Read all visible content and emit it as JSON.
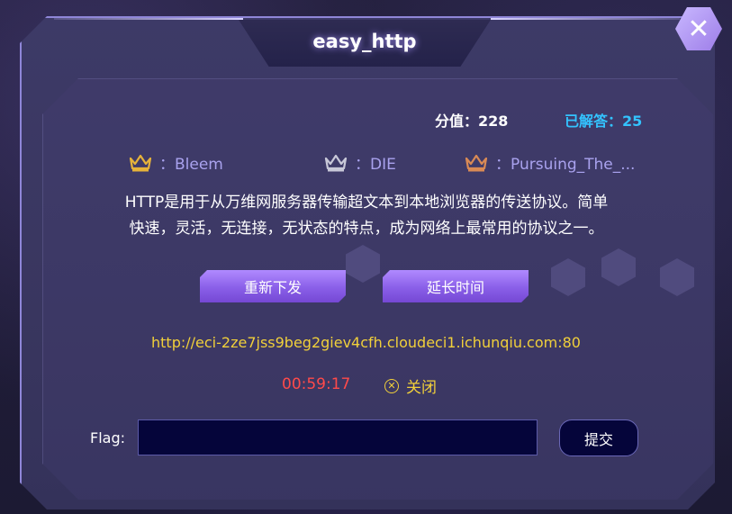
{
  "modal": {
    "title": "easy_http",
    "close_icon": "close-icon"
  },
  "stats": {
    "score_text": "分值：228",
    "solved_text": "已解答：25"
  },
  "ranks": [
    {
      "medal": "gold",
      "color": "#e6b33a",
      "text": "：Bleem"
    },
    {
      "medal": "silver",
      "color": "#c8c8d8",
      "text": "：DIE"
    },
    {
      "medal": "bronze",
      "color": "#d98a55",
      "text": "：Pursuing_The_..."
    }
  ],
  "description": {
    "line1": "HTTP是用于从万维网服务器传输超文本到本地浏览器的传送协议。简单",
    "line2": "快速，灵活，无连接，无状态的特点，成为网络上最常用的协议之一。"
  },
  "actions": {
    "redeploy_label": "重新下发",
    "extend_label": "延长时间"
  },
  "instance": {
    "url": "http://eci-2ze7jss9beg2giev4cfh.cloudeci1.ichunqiu.com:80",
    "timer": "00:59:17",
    "close_label": "关闭",
    "close_icon": "x-circle-icon"
  },
  "flag": {
    "label": "Flag:",
    "value": "",
    "placeholder": "",
    "submit_label": "提交"
  },
  "colors": {
    "accent_purple": "#8a5fe8",
    "solved_blue": "#33c3ff",
    "url_yellow": "#f1d03a",
    "timer_red": "#ff4a4a"
  }
}
